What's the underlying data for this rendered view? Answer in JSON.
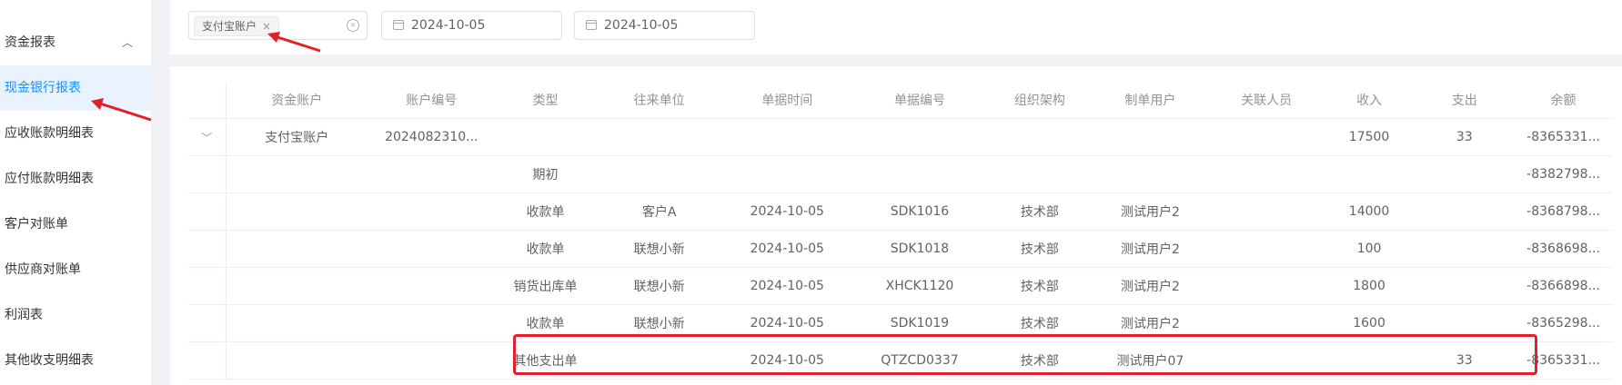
{
  "sidebar": {
    "items": [
      {
        "label": "资金报表",
        "expanded": true,
        "chevron": "chevron-up-icon"
      },
      {
        "label": "现金银行报表",
        "active": true
      },
      {
        "label": "应收账款明细表"
      },
      {
        "label": "应付账款明细表"
      },
      {
        "label": "客户对账单"
      },
      {
        "label": "供应商对账单"
      },
      {
        "label": "利润表"
      },
      {
        "label": "其他收支明细表"
      }
    ]
  },
  "filters": {
    "account_tag": "支付宝账户",
    "start_date": "2024-10-05",
    "end_date": "2024-10-05"
  },
  "table": {
    "columns": [
      "资金账户",
      "账户编号",
      "类型",
      "往来单位",
      "单据时间",
      "单据编号",
      "组织架构",
      "制单用户",
      "关联人员",
      "收入",
      "支出",
      "余额"
    ],
    "summary_row": [
      "支付宝账户",
      "2024082310...",
      "",
      "",
      "",
      "",
      "",
      "",
      "",
      "17500",
      "33",
      "-8365331..."
    ],
    "rows": [
      [
        "",
        "",
        "期初",
        "",
        "",
        "",
        "",
        "",
        "",
        "",
        "",
        "-8382798..."
      ],
      [
        "",
        "",
        "收款单",
        "客户A",
        "2024-10-05",
        "SDK1016",
        "技术部",
        "测试用户2",
        "",
        "14000",
        "",
        "-8368798..."
      ],
      [
        "",
        "",
        "收款单",
        "联想小新",
        "2024-10-05",
        "SDK1018",
        "技术部",
        "测试用户2",
        "",
        "100",
        "",
        "-8368698..."
      ],
      [
        "",
        "",
        "销货出库单",
        "联想小新",
        "2024-10-05",
        "XHCK1120",
        "技术部",
        "测试用户2",
        "",
        "1800",
        "",
        "-8366898..."
      ],
      [
        "",
        "",
        "收款单",
        "联想小新",
        "2024-10-05",
        "SDK1019",
        "技术部",
        "测试用户2",
        "",
        "1600",
        "",
        "-8365298..."
      ],
      [
        "",
        "",
        "其他支出单",
        "",
        "2024-10-05",
        "QTZCD0337",
        "技术部",
        "测试用户07",
        "",
        "",
        "33",
        "-8365331..."
      ]
    ]
  },
  "colors": {
    "accent": "#1890ff",
    "active_bg": "#e8f3ff",
    "annotation_red": "#e0202a"
  }
}
